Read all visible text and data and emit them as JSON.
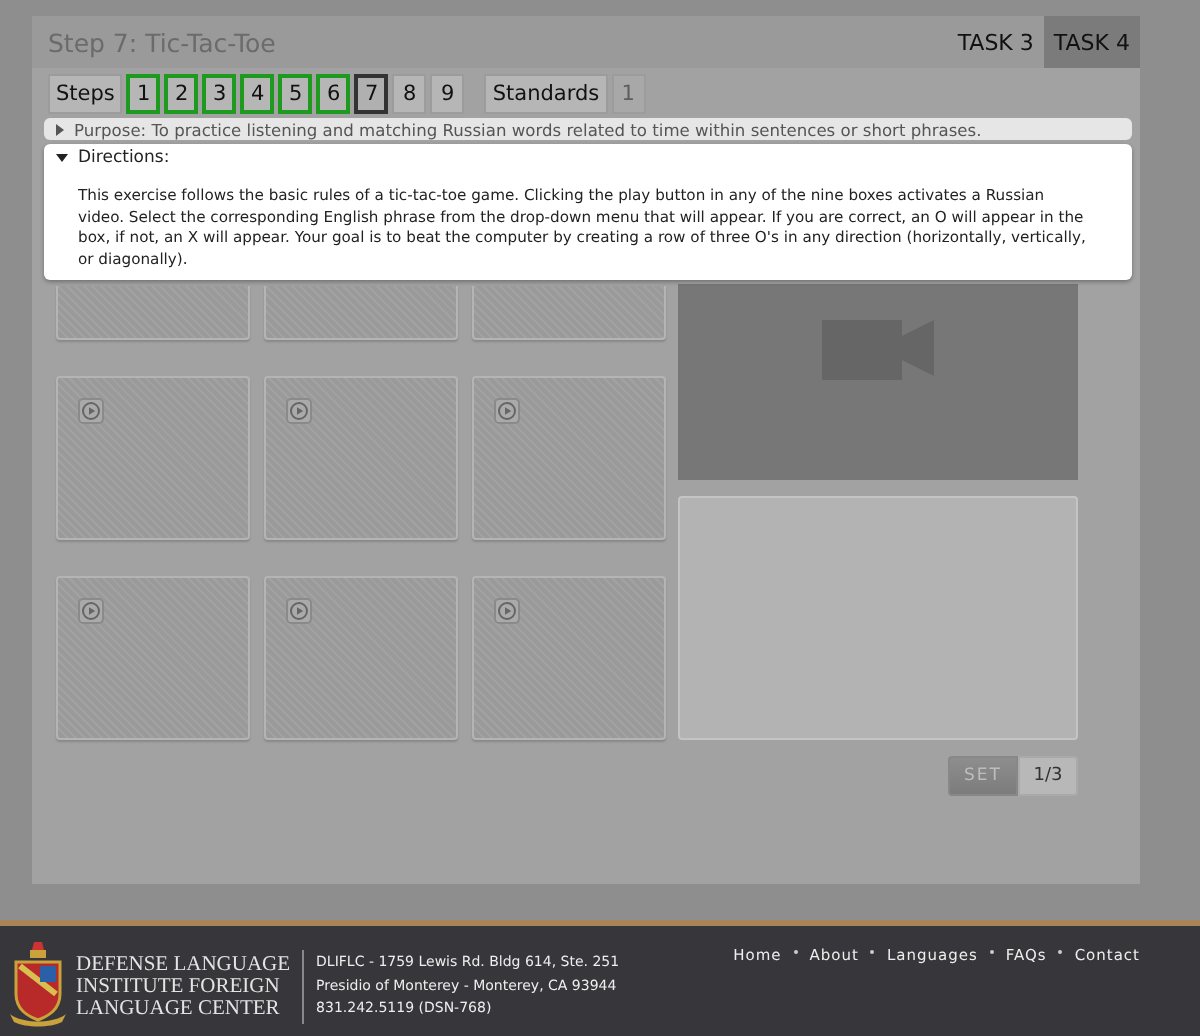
{
  "header": {
    "title": "Step 7: Tic-Tac-Toe",
    "tabs": [
      {
        "label": "TASK 3",
        "selected": false
      },
      {
        "label": "TASK 4",
        "selected": true
      }
    ]
  },
  "steps": {
    "label": "Steps",
    "items": [
      {
        "label": "1",
        "completed": true,
        "selected": false
      },
      {
        "label": "2",
        "completed": true,
        "selected": false
      },
      {
        "label": "3",
        "completed": true,
        "selected": false
      },
      {
        "label": "4",
        "completed": true,
        "selected": false
      },
      {
        "label": "5",
        "completed": true,
        "selected": false
      },
      {
        "label": "6",
        "completed": true,
        "selected": false
      },
      {
        "label": "7",
        "completed": false,
        "selected": true
      },
      {
        "label": "8",
        "completed": false,
        "selected": false
      },
      {
        "label": "9",
        "completed": false,
        "selected": false
      }
    ]
  },
  "standards": {
    "label": "Standards",
    "items": [
      {
        "label": "1",
        "disabled": true
      }
    ]
  },
  "purpose": {
    "text": "Purpose: To practice listening and matching Russian words related to time within sentences or short phrases.",
    "expanded": false
  },
  "directions": {
    "title": "Directions:",
    "expanded": true,
    "text": "This exercise follows the basic rules of a tic-tac-toe game. Clicking the play button in any of the nine boxes activates a Russian video. Select the corresponding English phrase from the drop-down menu that will appear. If you are correct, an O will appear in the box, if not, an X will appear. Your goal is to beat the computer by creating a row of three O's in any direction (horizontally, vertically, or diagonally)."
  },
  "board": {
    "cells": [
      {
        "kind": "covered"
      },
      {
        "kind": "covered"
      },
      {
        "kind": "covered"
      },
      {
        "kind": "play"
      },
      {
        "kind": "play"
      },
      {
        "kind": "play"
      },
      {
        "kind": "play"
      },
      {
        "kind": "play"
      },
      {
        "kind": "play"
      }
    ]
  },
  "set": {
    "label": "SET",
    "counter": "1/3"
  },
  "footer": {
    "org_name": [
      "DEFENSE LANGUAGE",
      "INSTITUTE FOREIGN",
      "LANGUAGE CENTER"
    ],
    "address": [
      "DLIFLC - 1759 Lewis Rd. Bldg 614, Ste. 251",
      "Presidio of Monterey - Monterey, CA 93944",
      "831.242.5119 (DSN-768)"
    ],
    "links": [
      "Home",
      "About",
      "Languages",
      "FAQs",
      "Contact"
    ]
  }
}
